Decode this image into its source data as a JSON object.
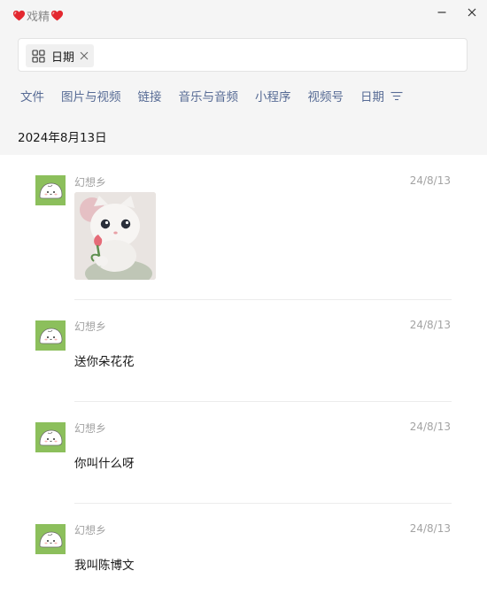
{
  "window": {
    "title": "戏精",
    "title_decoration": "heart-icon",
    "controls": [
      "minimize-icon",
      "close-icon"
    ]
  },
  "search": {
    "chip_label": "日期",
    "chip_icon": "grid-icon",
    "chip_remove_icon": "close-icon"
  },
  "filters": [
    {
      "label": "文件"
    },
    {
      "label": "图片与视频"
    },
    {
      "label": "链接"
    },
    {
      "label": "音乐与音频"
    },
    {
      "label": "小程序"
    },
    {
      "label": "视频号"
    },
    {
      "label": "日期"
    }
  ],
  "date_heading": "2024年8月13日",
  "messages": [
    {
      "sender": "幻想乡",
      "time": "24/8/13",
      "type": "image",
      "image_desc": "white-cat-holding-tulip-photo"
    },
    {
      "sender": "幻想乡",
      "time": "24/8/13",
      "type": "text",
      "text": "送你朵花花"
    },
    {
      "sender": "幻想乡",
      "time": "24/8/13",
      "type": "text",
      "text": "你叫什么呀"
    },
    {
      "sender": "幻想乡",
      "time": "24/8/13",
      "type": "text",
      "text": "我叫陈博文"
    }
  ],
  "colors": {
    "accent_link": "#576b95",
    "meta_gray": "#a3a3a3",
    "header_bg": "#f5f5f5",
    "avatar_bg": "#8cbf5c",
    "heart_red": "#e3282f"
  }
}
